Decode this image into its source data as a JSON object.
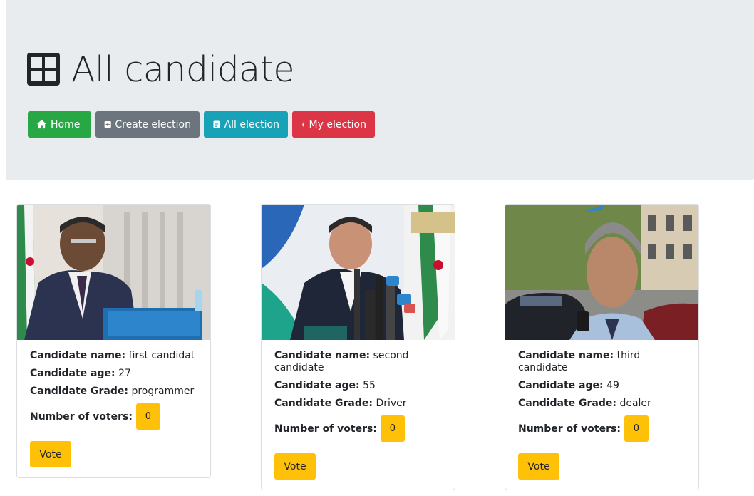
{
  "header": {
    "title": "All candidate",
    "title_icon": "grid-icon"
  },
  "nav": {
    "home": {
      "label": "Home",
      "icon": "home-icon",
      "color": "#28a745"
    },
    "create": {
      "label": "Create election",
      "icon": "plus-square-icon",
      "color": "#6c757d"
    },
    "all": {
      "label": "All election",
      "icon": "list-document-icon",
      "color": "#17a2b8"
    },
    "my": {
      "label": "My election",
      "icon": "person-icon",
      "color": "#dc3545"
    }
  },
  "labels": {
    "name": "Candidate name:",
    "age": "Candidate age:",
    "grade": "Candidate Grade:",
    "voters": "Number of voters:",
    "vote": "Vote"
  },
  "candidates": [
    {
      "name": "first candidat",
      "age": "27",
      "grade": "programmer",
      "voters": "0"
    },
    {
      "name": "second candidate",
      "age": "55",
      "grade": "Driver",
      "voters": "0"
    },
    {
      "name": "third candidate",
      "age": "49",
      "grade": "dealer",
      "voters": "0"
    }
  ],
  "colors": {
    "jumbotron": "#e9ecef",
    "warning": "#ffc107"
  }
}
